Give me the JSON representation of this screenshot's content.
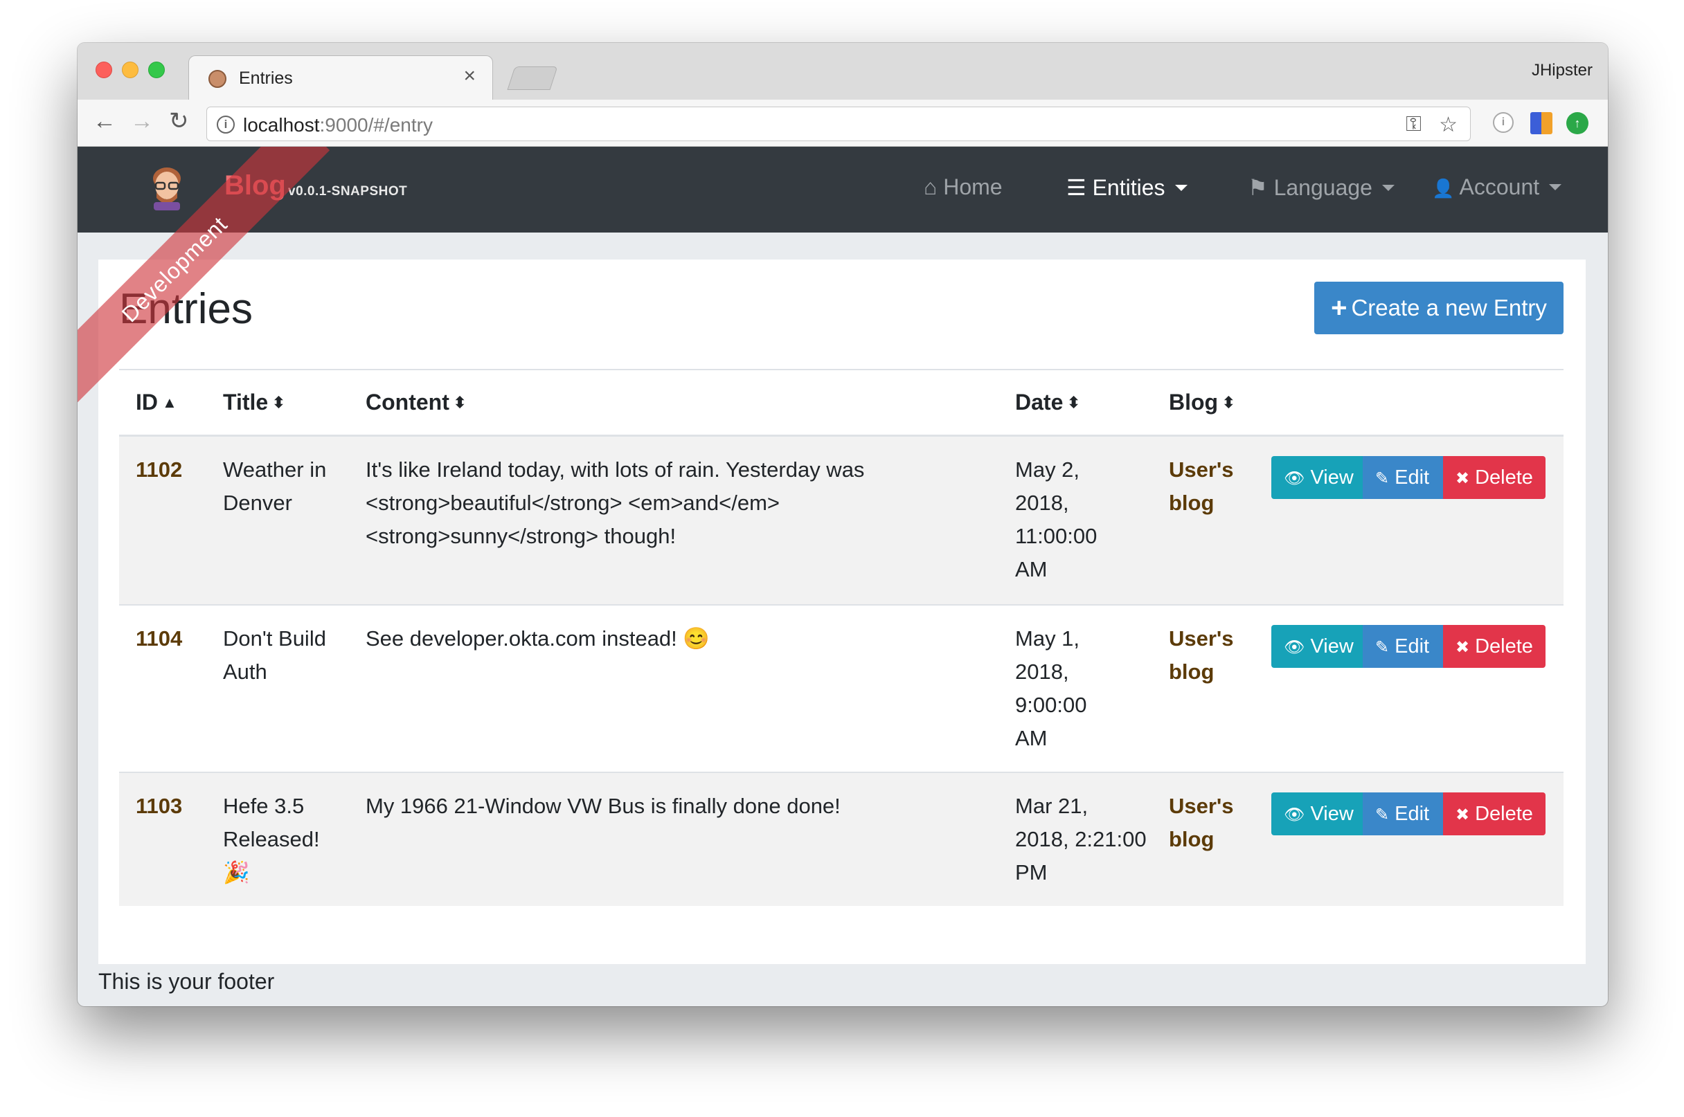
{
  "browser": {
    "tab_title": "Entries",
    "tab_close": "×",
    "profile_name": "JHipster",
    "url_host": "localhost",
    "url_rest": ":9000/#/entry",
    "back_glyph": "←",
    "forward_glyph": "→",
    "reload_glyph": "↻",
    "key_glyph": "⚿",
    "star_glyph": "☆"
  },
  "navbar": {
    "brand": "Blog",
    "version": "v0.0.1-SNAPSHOT",
    "home_icon": "⌂",
    "home": "Home",
    "entities_icon": "☰",
    "entities": "Entities",
    "language_icon": "⚑",
    "language": "Language",
    "account_icon": "👤",
    "account": "Account",
    "ribbon": "Development"
  },
  "page": {
    "title": "Entries",
    "create_icon": "+",
    "create_button": "Create a new Entry",
    "footer": "This is your footer"
  },
  "table": {
    "headers": {
      "id": "ID",
      "id_sort": "▲",
      "title": "Title",
      "title_sort": "⬍",
      "content": "Content",
      "content_sort": "⬍",
      "date": "Date",
      "date_sort": "⬍",
      "blog": "Blog",
      "blog_sort": "⬍"
    },
    "actions": {
      "view_icon": "👁",
      "view": "View",
      "edit_icon": "✎",
      "edit": "Edit",
      "delete_icon": "✖",
      "delete": "Delete"
    },
    "rows": [
      {
        "id": "1102",
        "title": "Weather in Denver",
        "content": "It's like Ireland today, with lots of rain. Yesterday was <strong>beautiful</strong> <em>and</em> <strong>sunny</strong> though!",
        "date": "May 2, 2018, 11:00:00 AM",
        "blog": "User's blog"
      },
      {
        "id": "1104",
        "title": "Don't Build Auth",
        "content": "See developer.okta.com instead! 😊",
        "date": "May 1, 2018, 9:00:00 AM",
        "blog": "User's blog"
      },
      {
        "id": "1103",
        "title": "Hefe 3.5 Released! 🎉",
        "content": "My 1966 21-Window VW Bus is finally done done!",
        "date": "Mar 21, 2018, 2:21:00 PM",
        "blog": "User's blog"
      }
    ]
  },
  "colors": {
    "navbar_bg": "#343a40",
    "brand": "#ed6f73",
    "primary": "#3a87c9",
    "info": "#17a2b8",
    "danger": "#e2354a",
    "link_brown": "#5c3b09"
  }
}
